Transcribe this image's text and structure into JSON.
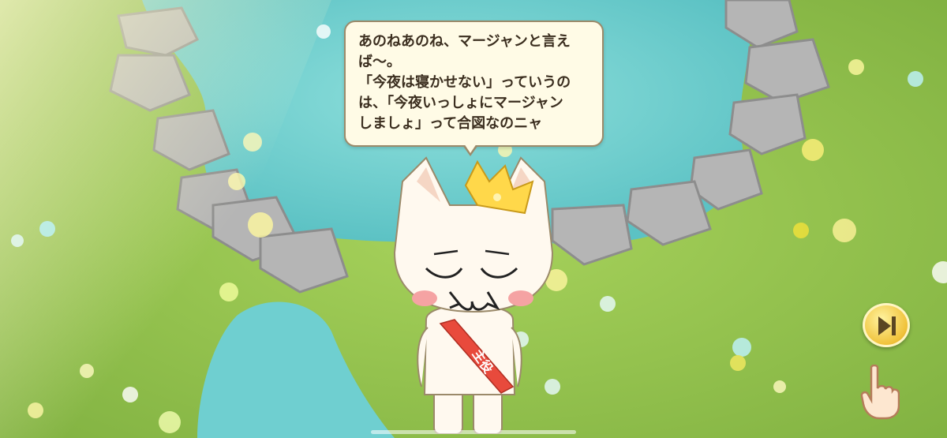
{
  "dialogue": {
    "lines": [
      "あのねあのね、マージャンと言え",
      "ば〜。",
      "「今夜は寝かせない」っていうの",
      "は、「今夜いっしょにマージャン",
      "しましょ」って合図なのニャ"
    ]
  },
  "character": {
    "sash_text": "主役"
  },
  "controls": {
    "skip_icon": "skip-forward-icon",
    "hand_icon": "pointing-hand-icon"
  },
  "colors": {
    "grass": "#8fbf4a",
    "water": "#6fcfd0",
    "rock": "#a9a9a9",
    "bubble_bg": "#fffbe6",
    "skip_button": "#f0c23a"
  }
}
